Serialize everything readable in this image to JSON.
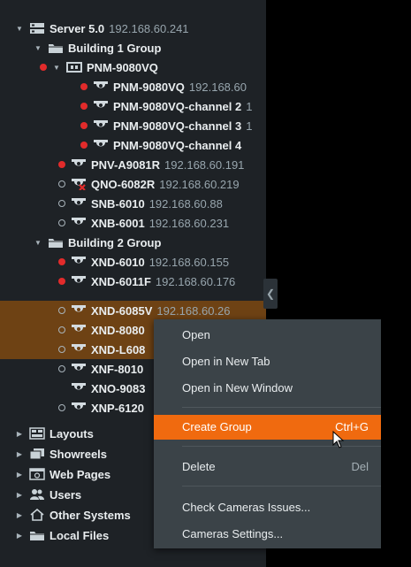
{
  "tree": {
    "server": {
      "name": "Server 5.0",
      "ip": "192.168.60.241"
    },
    "building1": {
      "name": "Building 1 Group"
    },
    "nvr": {
      "name": "PNM-9080VQ"
    },
    "nvr_ch1": {
      "name": "PNM-9080VQ",
      "ip": "192.168.60"
    },
    "nvr_ch2": {
      "name": "PNM-9080VQ-channel 2",
      "ip": "1"
    },
    "nvr_ch3": {
      "name": "PNM-9080VQ-channel 3",
      "ip": "1"
    },
    "nvr_ch4": {
      "name": "PNM-9080VQ-channel 4",
      "ip": ""
    },
    "cam_pnv": {
      "name": "PNV-A9081R",
      "ip": "192.168.60.191"
    },
    "cam_qno": {
      "name": "QNO-6082R",
      "ip": "192.168.60.219"
    },
    "cam_snb": {
      "name": "SNB-6010",
      "ip": "192.168.60.88"
    },
    "cam_xnb": {
      "name": "XNB-6001",
      "ip": "192.168.60.231"
    },
    "building2": {
      "name": "Building 2 Group"
    },
    "cam_xnd6010": {
      "name": "XND-6010",
      "ip": "192.168.60.155"
    },
    "cam_xnd6011": {
      "name": "XND-6011F",
      "ip": "192.168.60.176"
    },
    "cam_xnd6085": {
      "name": "XND-6085V",
      "ip": "192.168.60.26"
    },
    "cam_xnd8080": {
      "name": "XND-8080",
      "ip": ""
    },
    "cam_xndl608": {
      "name": "XND-L608",
      "ip": ""
    },
    "cam_xnf8010": {
      "name": "XNF-8010",
      "ip": ""
    },
    "cam_xno9083": {
      "name": "XNO-9083",
      "ip": ""
    },
    "cam_xnp6120": {
      "name": "XNP-6120",
      "ip": ""
    },
    "layouts": "Layouts",
    "showreels": "Showreels",
    "webpages": "Web Pages",
    "users": "Users",
    "othersystems": "Other Systems",
    "localfiles": "Local Files"
  },
  "menu": {
    "open": "Open",
    "open_new_tab": "Open in New Tab",
    "open_new_window": "Open in New Window",
    "create_group": "Create Group",
    "create_group_shortcut": "Ctrl+G",
    "delete": "Delete",
    "delete_shortcut": "Del",
    "check_issues": "Check Cameras Issues...",
    "camera_settings": "Cameras Settings..."
  },
  "icons": {
    "expand": "triangle-down",
    "collapse": "triangle-right",
    "camera": "camera-icon",
    "folder": "folder-icon",
    "server": "server-icon",
    "nvr": "nvr-icon"
  },
  "colors": {
    "accent": "#f06a0f",
    "selection": "#6e4214",
    "recording": "#e22b2b",
    "panel": "#1e2226",
    "menu": "#3b4348"
  }
}
